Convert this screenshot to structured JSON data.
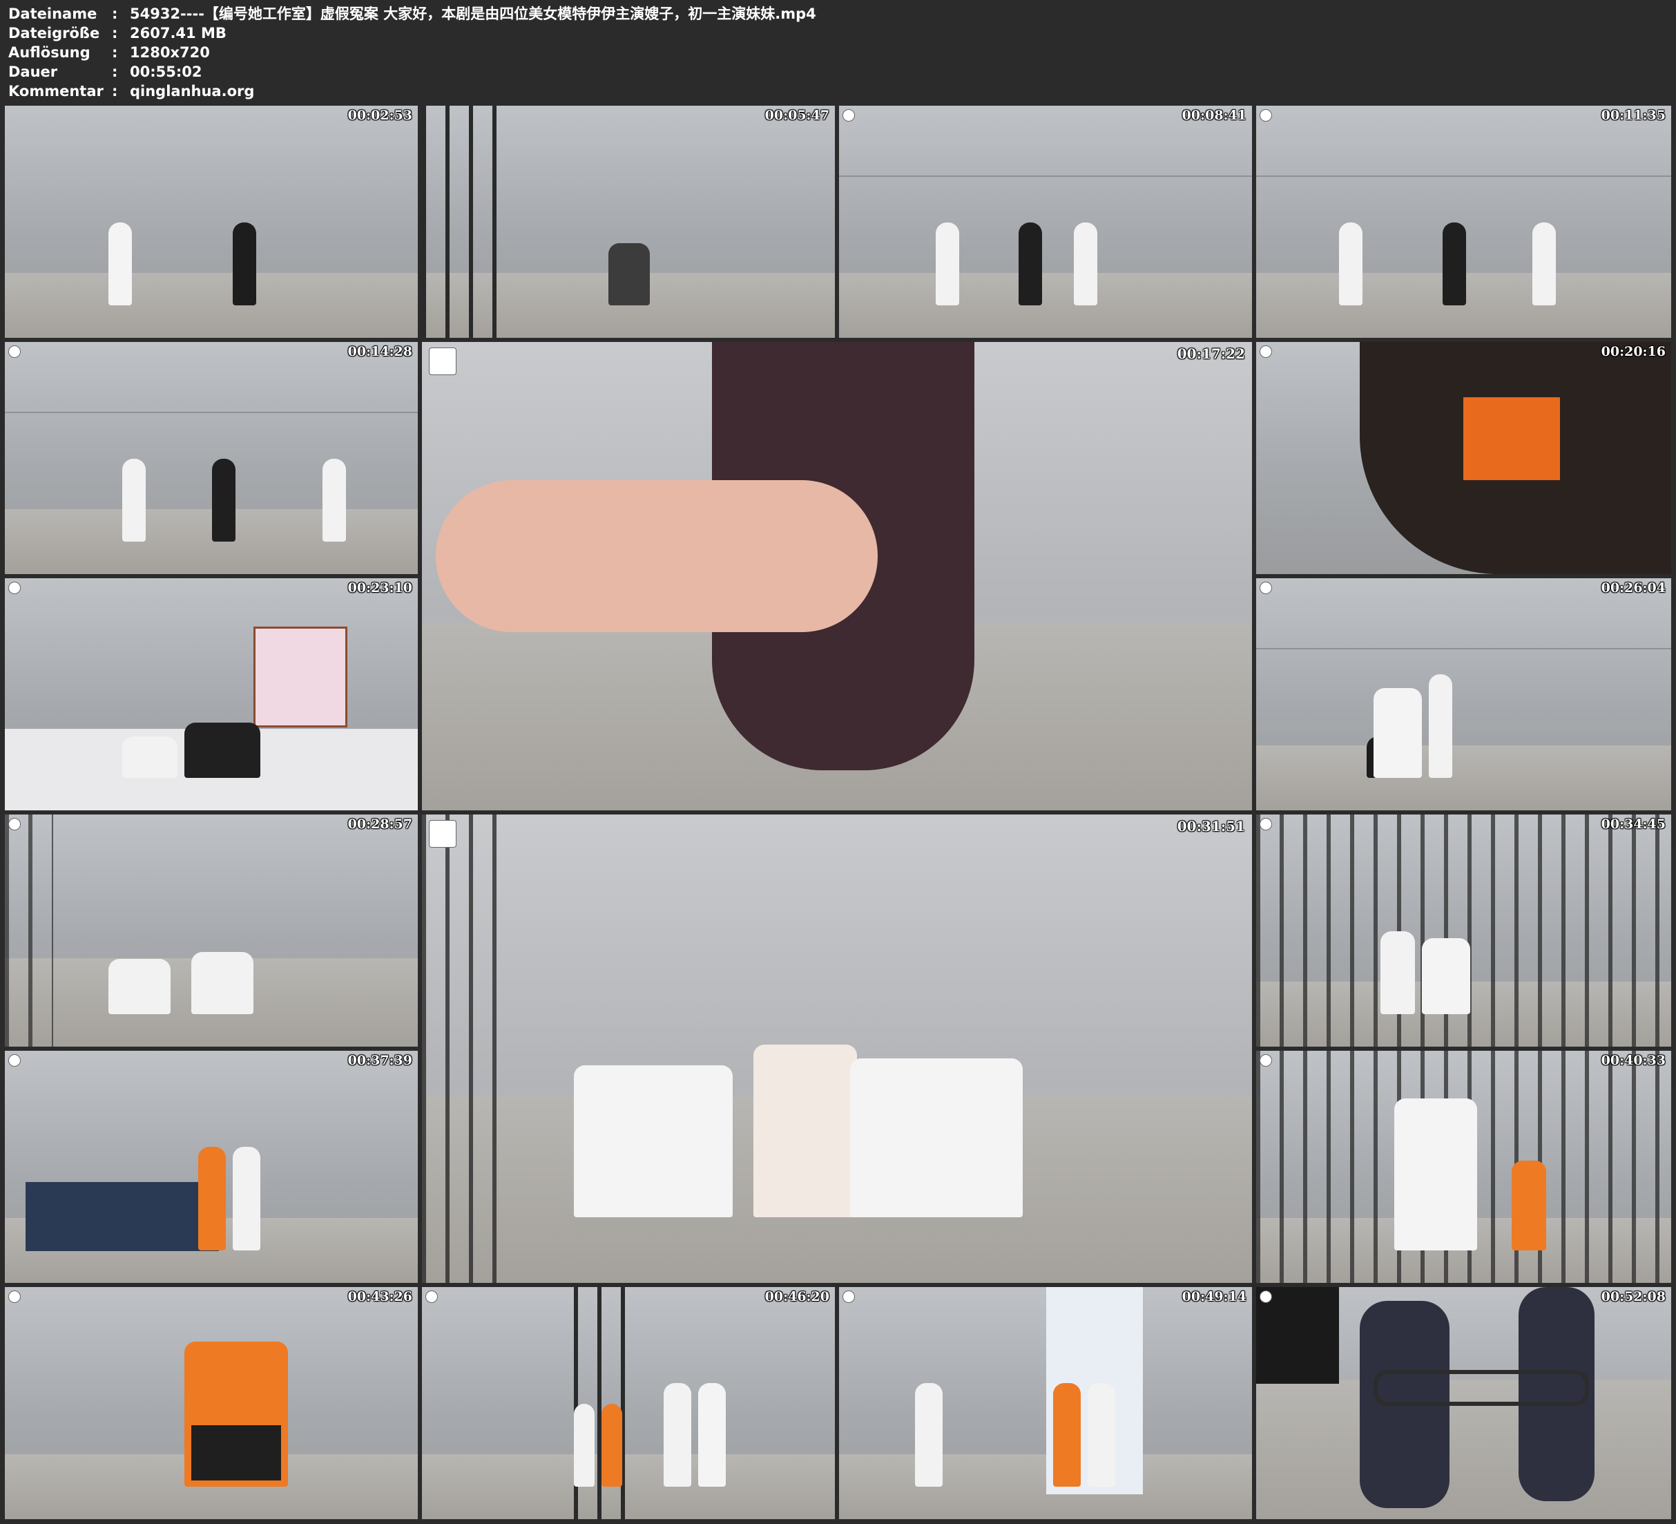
{
  "info": [
    {
      "label": "Dateiname",
      "value": "54932----【编号她工作室】虚假冤案 大家好，本剧是由四位美女模特伊伊主演嫂子，初一主演妹妹.mp4"
    },
    {
      "label": "Dateigröße",
      "value": "2607.41 MB"
    },
    {
      "label": "Auflösung",
      "value": "1280x720"
    },
    {
      "label": "Dauer",
      "value": "00:55:02"
    },
    {
      "label": "Kommentar",
      "value": "qinglanhua.org"
    }
  ],
  "separator": ":",
  "thumbnails": [
    "00:02:53",
    "00:05:47",
    "00:08:41",
    "00:11:35",
    "00:14:28",
    "00:17:22",
    "00:20:16",
    "00:23:10",
    "00:26:04",
    "00:28:57",
    "00:31:51",
    "00:34:45",
    "00:37:39",
    "00:40:33",
    "00:43:26",
    "00:46:20",
    "00:49:14",
    "00:52:08"
  ]
}
